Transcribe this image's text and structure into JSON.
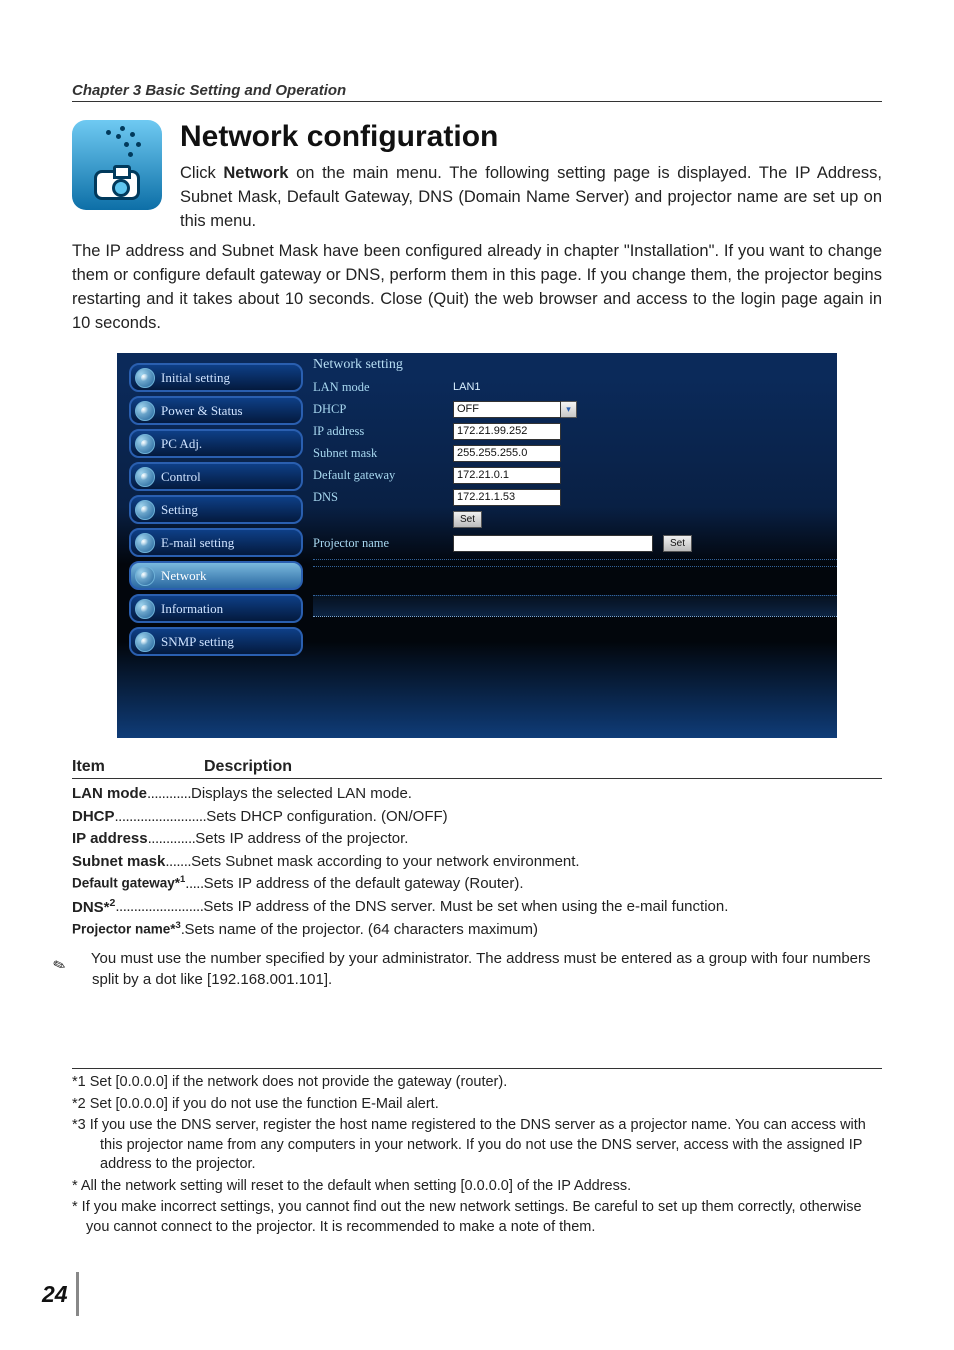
{
  "chapter": "Chapter 3 Basic Setting and Operation",
  "title": "Network configuration",
  "intro_html": "Click <b>Network</b> on the main menu. The following setting page is displayed. The IP Address, Subnet Mask, Default Gateway, DNS (Domain Name Server) and projector name are set up on this menu.",
  "para1": "The IP address and Subnet Mask have been configured already in chapter \"Installation\". If you want to change them or configure default gateway or DNS, perform them in this page. If you change them, the projector begins restarting and it takes about 10 seconds. Close (Quit) the web browser and access to the login page again in 10 seconds.",
  "menu": {
    "items": [
      "Initial setting",
      "Power & Status",
      "PC Adj.",
      "Control",
      "Setting",
      "E-mail setting",
      "Network",
      "Information",
      "SNMP setting"
    ],
    "active_index": 6
  },
  "panel": {
    "heading": "Network setting",
    "lan_mode_label": "LAN mode",
    "lan_mode_value": "LAN1",
    "dhcp_label": "DHCP",
    "dhcp_value": "OFF",
    "ip_label": "IP address",
    "ip_value": "172.21.99.252",
    "subnet_label": "Subnet mask",
    "subnet_value": "255.255.255.0",
    "gateway_label": "Default gateway",
    "gateway_value": "172.21.0.1",
    "dns_label": "DNS",
    "dns_value": "172.21.1.53",
    "set1": "Set",
    "projector_label": "Projector name",
    "projector_value": "",
    "set2": "Set"
  },
  "desc": {
    "item": "Item",
    "description": "Description",
    "rows": [
      {
        "k": "LAN mode",
        "dots": "............",
        "d": "Displays the selected LAN mode."
      },
      {
        "k": "DHCP",
        "dots": ".........................",
        "d": "Sets DHCP configuration. (ON/OFF)"
      },
      {
        "k": "IP address",
        "dots": ".............",
        "d": "Sets IP address of the projector."
      },
      {
        "k": "Subnet mask",
        "dots": ".......",
        "d": "Sets Subnet mask according to your network environment."
      },
      {
        "k": "Default gateway*1",
        "dots": ".....",
        "small": true,
        "d": "Sets IP address of the default gateway (Router)."
      },
      {
        "k": "DNS*2",
        "dots": "........................",
        "d": "Sets IP address of the DNS server. Must be set when using the e-mail function."
      },
      {
        "k": "Projector name*3",
        "dots": ".",
        "small": true,
        "d": "Sets name of the projector. (64 characters maximum)"
      }
    ],
    "note": "You must use the number specified by your administrator. The address must be entered as a group with four numbers split by a dot like [192.168.001.101]."
  },
  "footnotes": [
    "*1 Set [0.0.0.0] if the network does not provide the gateway (router).",
    "*2 Set [0.0.0.0] if you do not use the function E-Mail alert.",
    "*3 If you use the DNS server, register the host name registered to the DNS server as a projector name. You can access with this projector name from any computers in your network. If you do not use the DNS server, access with the assigned IP address to the projector.",
    "* All the network setting will reset to the default when setting [0.0.0.0] of the IP Address.",
    "* If you make incorrect settings, you cannot find out the new network settings. Be careful to set up them correctly, otherwise you cannot connect to the projector. It is recommended to make a note of them."
  ],
  "page_number": "24"
}
